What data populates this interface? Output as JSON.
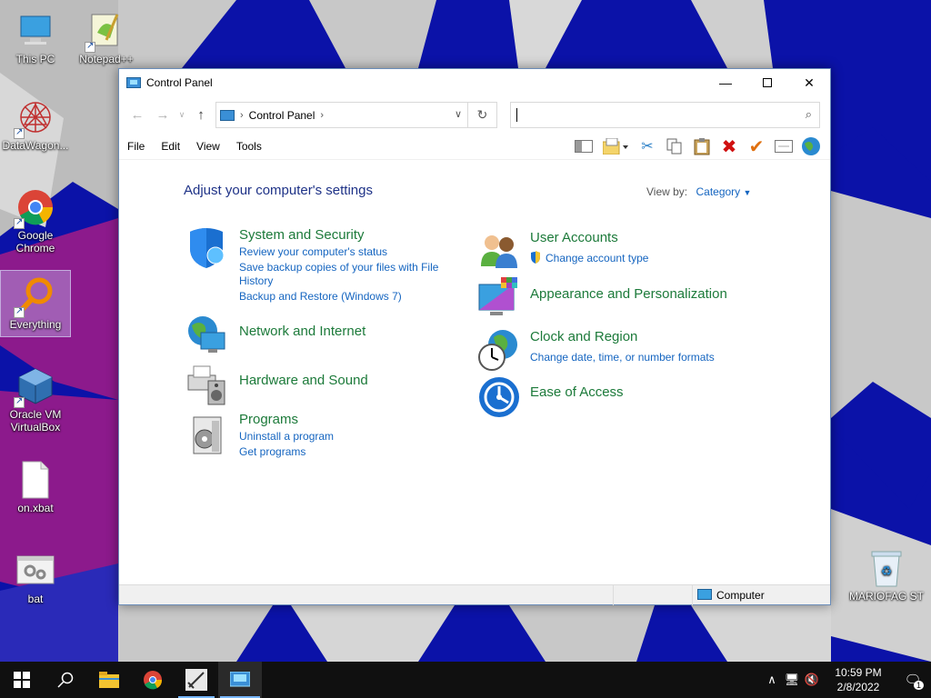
{
  "colors": {
    "accent_link": "#1565c0",
    "category_title": "#1c7a3a",
    "heading": "#1e3287",
    "taskbar": "#101010"
  },
  "desktop": {
    "icons": [
      {
        "label": "This PC",
        "icon": "computer-icon"
      },
      {
        "label": "Notepad++",
        "icon": "notepadpp-icon"
      },
      {
        "label": "DataWagon...",
        "icon": "datawagon-icon"
      },
      {
        "label": "Google Chrome",
        "icon": "chrome-icon"
      },
      {
        "label": "Everything",
        "icon": "everything-search-icon"
      },
      {
        "label": "Oracle VM VirtualBox",
        "icon": "virtualbox-icon"
      },
      {
        "label": "on.xbat",
        "icon": "file-icon"
      },
      {
        "label": "bat",
        "icon": "bat-file-icon"
      },
      {
        "label": "MARIOFAG ST",
        "icon": "recycle-bin-icon"
      }
    ]
  },
  "window": {
    "title": "Control Panel",
    "address": {
      "crumb": "Control Panel"
    },
    "search": {
      "placeholder": ""
    },
    "menu": [
      "File",
      "Edit",
      "View",
      "Tools"
    ],
    "heading": "Adjust your computer's settings",
    "view_by_label": "View by:",
    "view_by_value": "Category",
    "categories": {
      "system": {
        "title": "System and Security",
        "links": [
          "Review your computer's status",
          "Save backup copies of your files with File",
          "History",
          "Backup and Restore (Windows 7)"
        ]
      },
      "network": {
        "title": "Network and Internet"
      },
      "hardware": {
        "title": "Hardware and Sound"
      },
      "programs": {
        "title": "Programs",
        "links": [
          "Uninstall a program",
          "Get programs"
        ]
      },
      "users": {
        "title": "User Accounts",
        "links": [
          "Change account type"
        ]
      },
      "appearance": {
        "title": "Appearance and Personalization"
      },
      "clock": {
        "title": "Clock and Region",
        "links": [
          "Change date, time, or number formats"
        ]
      },
      "ease": {
        "title": "Ease of Access"
      }
    },
    "status": {
      "computer": "Computer"
    }
  },
  "taskbar": {
    "time": "10:59 PM",
    "date": "2/8/2022",
    "notification_count": "1"
  }
}
